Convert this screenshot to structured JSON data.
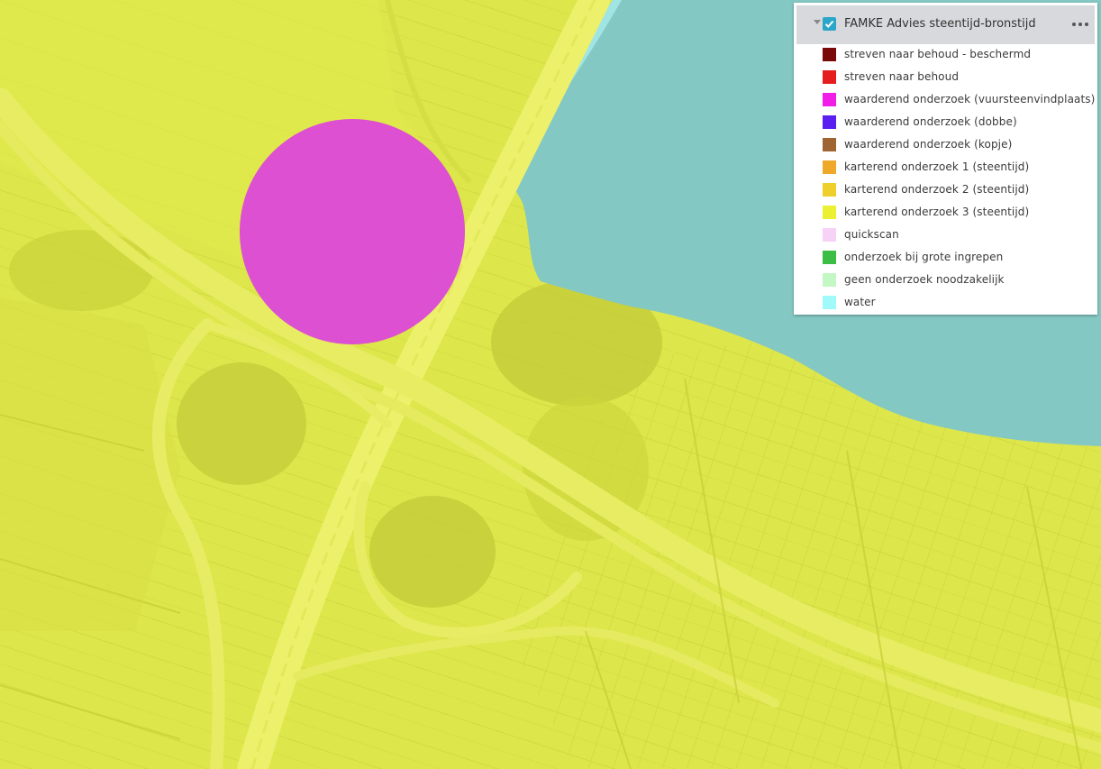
{
  "layer": {
    "title": "FAMKE Advies steentijd-bronstijd",
    "visible": true,
    "expand_icon": "caret-down-icon",
    "checkbox_icon": "checkbox-checked-icon",
    "menu_icon": "more-horizontal-icon"
  },
  "legend": {
    "items": [
      {
        "label": "streven naar behoud - beschermd",
        "color": "#7a0a0a"
      },
      {
        "label": "streven naar behoud",
        "color": "#e41e1e"
      },
      {
        "label": "waarderend onderzoek (vuursteenvindplaats)",
        "color": "#f01ee6"
      },
      {
        "label": "waarderend onderzoek (dobbe)",
        "color": "#5a1ef0"
      },
      {
        "label": "waarderend onderzoek (kopje)",
        "color": "#a06432"
      },
      {
        "label": "karterend onderzoek 1 (steentijd)",
        "color": "#efa92a"
      },
      {
        "label": "karterend onderzoek 2 (steentijd)",
        "color": "#efcf2a"
      },
      {
        "label": "karterend onderzoek 3 (steentijd)",
        "color": "#ebf032"
      },
      {
        "label": "quickscan",
        "color": "#f7d2f7"
      },
      {
        "label": "onderzoek bij grote ingrepen",
        "color": "#3cbe46"
      },
      {
        "label": "geen onderzoek noodzakelijk",
        "color": "#c3f7c3"
      },
      {
        "label": "water",
        "color": "#a0fafa"
      }
    ]
  },
  "map": {
    "base_color": "#dde64a",
    "water_color": "#84c8c4",
    "zone_color": "#db48d8"
  }
}
